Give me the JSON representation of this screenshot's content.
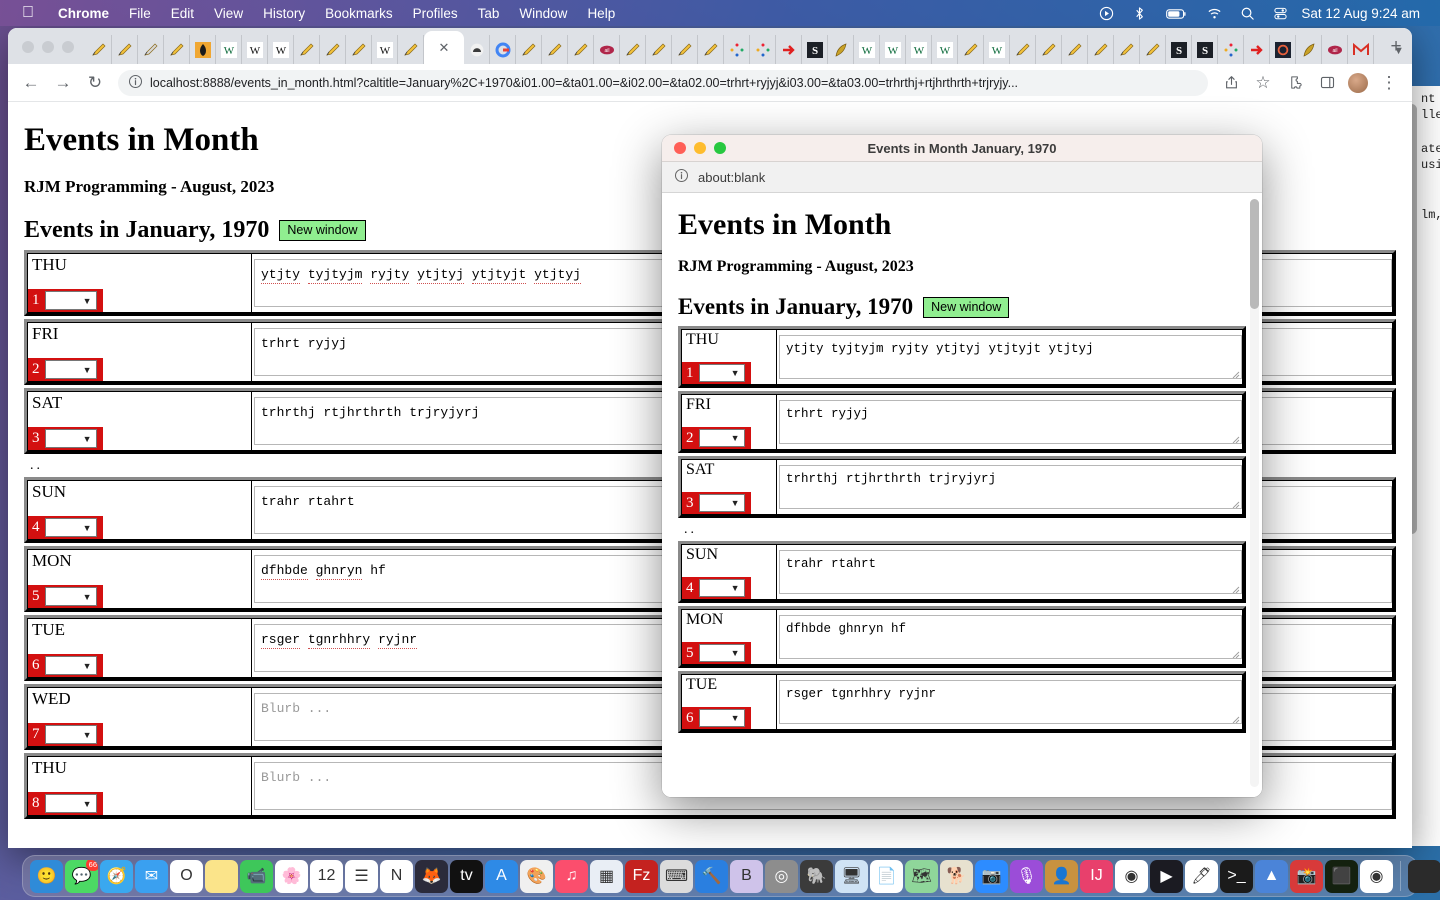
{
  "menubar": {
    "apple_icon": "apple-logo-icon",
    "items": [
      "Chrome",
      "File",
      "Edit",
      "View",
      "History",
      "Bookmarks",
      "Profiles",
      "Tab",
      "Window",
      "Help"
    ],
    "status_icons": [
      "control-center-play-icon",
      "bluetooth-icon",
      "battery-icon",
      "wifi-icon",
      "search-icon",
      "control-center-icon"
    ],
    "clock": "Sat 12 Aug  9:24 am"
  },
  "browser": {
    "back_icon": "back-arrow-icon",
    "forward_icon": "forward-arrow-icon",
    "reload_icon": "reload-icon",
    "site_info_icon": "info-circle-icon",
    "url": "localhost:8888/events_in_month.html?caltitle=January%2C+1970&i01.00=&ta01.00=&i02.00=&ta02.00=trhrt+ryjyj&i03.00=&ta03.00=trhrthj+rtjhrthrth+trjryjy...",
    "share_icon": "share-icon",
    "bookmark_icon": "star-icon",
    "extensions_icon": "puzzle-piece-icon",
    "sidepanel_icon": "side-panel-icon",
    "menu_icon": "three-dot-menu-icon",
    "new_tab_label": "+",
    "tab_list_icon": "chevron-down-icon",
    "active_tab_close_icon": "close-icon",
    "tab_count_before_active": 12,
    "tab_count_after_active": 40
  },
  "page": {
    "title": "Events in Month",
    "subtitle": "RJM Programming - August, 2023",
    "section_title": "Events in January, 1970",
    "new_window_button": "New window",
    "ellipsis_separator": "..",
    "textarea_placeholder": "Blurb ...",
    "days": [
      {
        "dow": "THU",
        "num": "1",
        "text": "ytjty tyjtyjm ryjty ytjtyj ytjtyjt ytjtyj",
        "spell": true
      },
      {
        "dow": "FRI",
        "num": "2",
        "text": "trhrt ryjyj",
        "spell": false
      },
      {
        "dow": "SAT",
        "num": "3",
        "text": "trhrthj rtjhrthrth trjryjyrj",
        "spell": false
      },
      {
        "dow": "SUN",
        "num": "4",
        "text": "trahr rtahrt",
        "spell": false
      },
      {
        "dow": "MON",
        "num": "5",
        "text": "dfhbde ghnryn hf",
        "spell": true
      },
      {
        "dow": "TUE",
        "num": "6",
        "text": "rsger tgnrhhry ryjnr",
        "spell": true
      },
      {
        "dow": "WED",
        "num": "7",
        "text": "",
        "spell": false
      },
      {
        "dow": "THU",
        "num": "8",
        "text": "",
        "spell": false
      }
    ]
  },
  "popup": {
    "window_title": "Events in Month January, 1970",
    "url": "about:blank",
    "site_info_icon": "info-circle-icon",
    "close_color": "#ff5f57",
    "minimize_color": "#febc2e",
    "zoom_color": "#28c840",
    "title": "Events in Month",
    "subtitle": "RJM Programming - August, 2023",
    "section_title": "Events in January, 1970",
    "new_window_button": "New window",
    "ellipsis_separator": "..",
    "days": [
      {
        "dow": "THU",
        "num": "1",
        "text": "ytjty tyjtyjm ryjty ytjtyj ytjtyjt ytjtyj"
      },
      {
        "dow": "FRI",
        "num": "2",
        "text": "trhrt ryjyj"
      },
      {
        "dow": "SAT",
        "num": "3",
        "text": "trhrthj rtjhrthrth trjryjyrj"
      },
      {
        "dow": "SUN",
        "num": "4",
        "text": "trahr rtahrt"
      },
      {
        "dow": "MON",
        "num": "5",
        "text": "dfhbde ghnryn hf"
      },
      {
        "dow": "TUE",
        "num": "6",
        "text": "rsger tgnrhhry ryjnr"
      }
    ]
  },
  "behind_window": {
    "fragments": [
      "nt",
      "lle",
      "ate",
      "usi",
      "lm,"
    ]
  },
  "colors": {
    "accent_red": "#d31010",
    "new_window_green": "#90ee90",
    "menubar_blue": "#2b6fa8",
    "page_background": "#ffffff"
  },
  "dock": {
    "apps": [
      {
        "name": "finder-icon",
        "glyph": "🙂",
        "bg": "#2f8bd8",
        "dot": true
      },
      {
        "name": "messages-icon",
        "glyph": "💬",
        "bg": "#4cd964",
        "dot": false,
        "badge": "66"
      },
      {
        "name": "safari-icon",
        "glyph": "🧭",
        "bg": "#3aa8ef",
        "dot": true
      },
      {
        "name": "mail-icon",
        "glyph": "✉",
        "bg": "#3aa0f0",
        "dot": true
      },
      {
        "name": "opera-icon",
        "glyph": "O",
        "bg": "#ffffff",
        "dot": false
      },
      {
        "name": "notes-icon",
        "glyph": "",
        "bg": "#fbe48a",
        "dot": false
      },
      {
        "name": "facetime-icon",
        "glyph": "📹",
        "bg": "#3ec75a",
        "dot": false
      },
      {
        "name": "photos-icon",
        "glyph": "🌸",
        "bg": "#ffffff",
        "dot": false
      },
      {
        "name": "calendar-icon",
        "glyph": "12",
        "bg": "#ffffff",
        "dot": false
      },
      {
        "name": "reminders-icon",
        "glyph": "☰",
        "bg": "#ffffff",
        "dot": false
      },
      {
        "name": "notability-icon",
        "glyph": "N",
        "bg": "#ffffff",
        "dot": false
      },
      {
        "name": "firefox-icon",
        "glyph": "🦊",
        "bg": "#2b2b3b",
        "dot": false
      },
      {
        "name": "apple-tv-icon",
        "glyph": "tv",
        "bg": "#111111",
        "dot": false
      },
      {
        "name": "app-store-icon",
        "glyph": "A",
        "bg": "#2e8ae6",
        "dot": false
      },
      {
        "name": "paint-icon",
        "glyph": "🎨",
        "bg": "#f0f0f0",
        "dot": false
      },
      {
        "name": "music-icon",
        "glyph": "♫",
        "bg": "#fb4e6d",
        "dot": false
      },
      {
        "name": "launchpad-icon",
        "glyph": "▦",
        "bg": "#e9eef5",
        "dot": false
      },
      {
        "name": "filezilla-icon",
        "glyph": "Fz",
        "bg": "#c4221f",
        "dot": true
      },
      {
        "name": "calculator-icon",
        "glyph": "⌨",
        "bg": "#dcdcdc",
        "dot": false
      },
      {
        "name": "xcode-icon",
        "glyph": "🔨",
        "bg": "#2a7fe0",
        "dot": false
      },
      {
        "name": "bbedit-icon",
        "glyph": "B",
        "bg": "#cfc3ea",
        "dot": true
      },
      {
        "name": "target-icon",
        "glyph": "◎",
        "bg": "#8d8d8d",
        "dot": false,
        "badge": ""
      },
      {
        "name": "evernote-icon",
        "glyph": "🐘",
        "bg": "#3b3b3b",
        "dot": true
      },
      {
        "name": "screens-icon",
        "glyph": "🖥",
        "bg": "#cfe3f5",
        "dot": false
      },
      {
        "name": "textedit-icon",
        "glyph": "📄",
        "bg": "#ffffff",
        "dot": false
      },
      {
        "name": "maps-icon",
        "glyph": "🗺",
        "bg": "#8fd69a",
        "dot": false
      },
      {
        "name": "gimp-icon",
        "glyph": "🐕",
        "bg": "#e7e1cf",
        "dot": false
      },
      {
        "name": "zoom-icon",
        "glyph": "📷",
        "bg": "#2d8cff",
        "dot": false
      },
      {
        "name": "podcasts-icon",
        "glyph": "🎙",
        "bg": "#9b4dd8",
        "dot": false
      },
      {
        "name": "contacts-icon",
        "glyph": "👤",
        "bg": "#c8923f",
        "dot": false
      },
      {
        "name": "intellij-icon",
        "glyph": "IJ",
        "bg": "#e8406c",
        "dot": false
      },
      {
        "name": "chrome-icon",
        "glyph": "◉",
        "bg": "#ffffff",
        "dot": true
      },
      {
        "name": "quicktime-icon",
        "glyph": "▶",
        "bg": "#1b1b22",
        "dot": false
      },
      {
        "name": "inkscape-icon",
        "glyph": "🖊",
        "bg": "#ffffff",
        "dot": false
      },
      {
        "name": "terminal-icon",
        "glyph": ">_",
        "bg": "#1b1b1b",
        "dot": true
      },
      {
        "name": "filemaker-icon",
        "glyph": "▲",
        "bg": "#4b84d8",
        "dot": false
      },
      {
        "name": "photobooth-icon",
        "glyph": "📸",
        "bg": "#d83a3a",
        "dot": false
      },
      {
        "name": "console-icon",
        "glyph": "⬛",
        "bg": "#14210f",
        "dot": false
      },
      {
        "name": "chrome-canary-icon",
        "glyph": "◉",
        "bg": "#ffffff",
        "dot": false
      }
    ],
    "minimized_count": 7,
    "trash_icon": "trash-icon"
  }
}
